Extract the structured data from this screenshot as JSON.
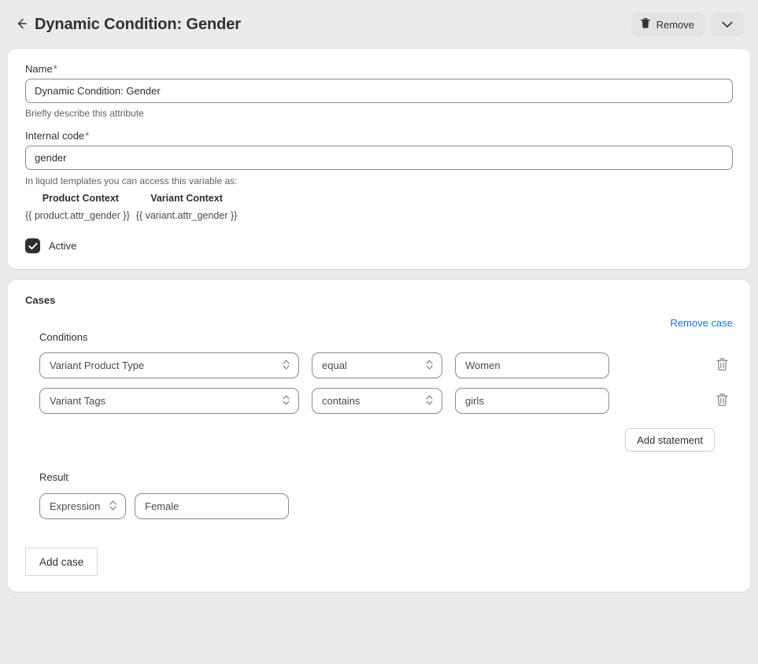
{
  "header": {
    "back_icon": "arrow-left-icon",
    "title": "Dynamic Condition: Gender",
    "remove_label": "Remove",
    "remove_icon": "trash-icon",
    "caret_icon": "chevron-down-icon"
  },
  "details": {
    "name_label": "Name",
    "name_required": "*",
    "name_value": "Dynamic Condition: Gender",
    "name_placeholder": "Name",
    "name_helper": "Briefly describe this attribute",
    "code_label": "Internal code",
    "code_required": "*",
    "code_value": "gender",
    "code_placeholder": "Internal code",
    "liquid_note": "In liquid templates you can access this variable as:",
    "liquid_headers": [
      "Product Context",
      "Variant Context"
    ],
    "liquid_values": [
      "{{ product.attr_gender }}",
      "{{ variant.attr_gender }}"
    ],
    "active_label": "Active",
    "active_checked": true
  },
  "cases": {
    "title": "Cases",
    "remove_case_label": "Remove case",
    "conditions_label": "Conditions",
    "conditions": [
      {
        "attribute": "Variant Product Type",
        "operator": "equal",
        "value": "Women",
        "delete_icon": "trash-icon"
      },
      {
        "attribute": "Variant Tags",
        "operator": "contains",
        "value": "girls",
        "delete_icon": "trash-icon"
      }
    ],
    "add_statement_label": "Add statement",
    "result_label": "Result",
    "result_type": "Expression",
    "result_value": "Female",
    "add_case_label": "Add case"
  },
  "colors": {
    "page_bg": "#ebebeb",
    "card_bg": "#ffffff",
    "text": "#303030",
    "muted": "#616161",
    "link": "#1e6fe8",
    "required": "#c3462f",
    "border": "#8a8a8a",
    "checkbox": "#303030"
  }
}
